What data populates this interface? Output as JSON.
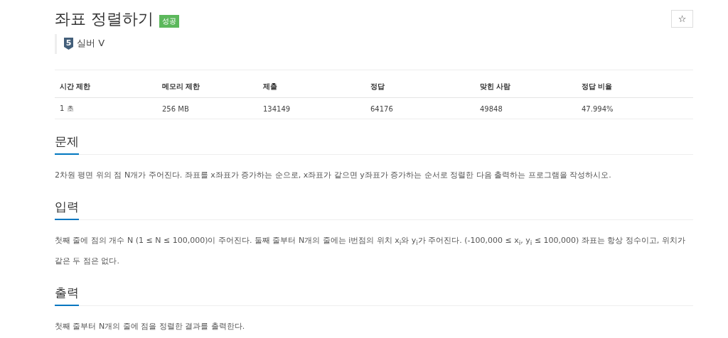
{
  "title": "좌표 정렬하기",
  "status_badge": "성공",
  "star_button": "☆",
  "tier": {
    "level": "5",
    "name": "실버 V"
  },
  "stats": {
    "columns": [
      "시간 제한",
      "메모리 제한",
      "제출",
      "정답",
      "맞힌 사람",
      "정답 비율"
    ],
    "row": [
      "1 초",
      "256 MB",
      "134149",
      "64176",
      "49848",
      "47.994%"
    ]
  },
  "sections": [
    {
      "heading": "문제",
      "text": "2차원 평면 위의 점 N개가 주어진다. 좌표를 x좌표가 증가하는 순으로, x좌표가 같으면 y좌표가 증가하는 순서로 정렬한 다음 출력하는 프로그램을 작성하시오."
    },
    {
      "heading": "입력",
      "text": "첫째 줄에 점의 개수 N (1 ≤ N ≤ 100,000)이 주어진다. 둘째 줄부터 N개의 줄에는 i번점의 위치 x$_{i}$와 y$_{i}$가 주어진다. (-100,000 ≤ x$_{i}$, y$_{i}$ ≤ 100,000) 좌표는 항상 정수이고, 위치가 같은 두 점은 없다."
    },
    {
      "heading": "출력",
      "text": "첫째 줄부터 N개의 줄에 점을 정렬한 결과를 출력한다."
    }
  ]
}
